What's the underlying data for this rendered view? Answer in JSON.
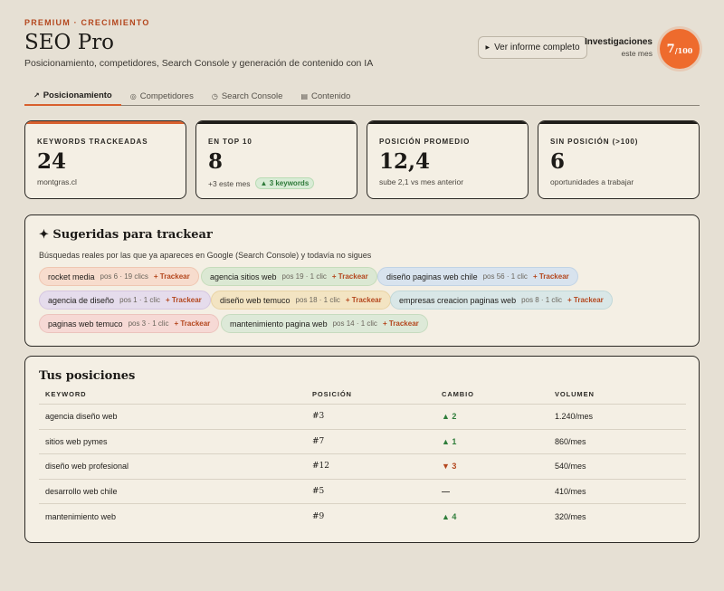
{
  "header": {
    "eyebrow": "PREMIUM · CRECIMIENTO",
    "title": "SEO Pro",
    "subtitle": "Posicionamiento, competidores, Search Console y generación de contenido con IA",
    "report_button": "Ver informe completo",
    "investigations_title": "Investigaciones",
    "investigations_sub": "este mes",
    "quota_used": "7",
    "quota_total": "/100"
  },
  "tabs": [
    {
      "icon": "↗",
      "label": "Posicionamiento"
    },
    {
      "icon": "◎",
      "label": "Competidores"
    },
    {
      "icon": "◷",
      "label": "Search Console"
    },
    {
      "icon": "▤",
      "label": "Contenido"
    }
  ],
  "stats": [
    {
      "label": "KEYWORDS TRACKEADAS",
      "value": "24",
      "note": "montgras.cl",
      "pill": ""
    },
    {
      "label": "EN TOP 10",
      "value": "8",
      "note": "+3 este mes",
      "pill": "▲ 3 keywords"
    },
    {
      "label": "POSICIÓN PROMEDIO",
      "value": "12,4",
      "note": "sube 2,1 vs mes anterior",
      "pill": ""
    },
    {
      "label": "SIN POSICIÓN (>100)",
      "value": "6",
      "note": "oportunidades a trabajar",
      "pill": ""
    }
  ],
  "suggestions": {
    "title": "✦ Sugeridas para trackear",
    "description": "Búsquedas reales por las que ya apareces en Google (Search Console) y todavía no sigues",
    "add_label": "+ Trackear",
    "chips": [
      {
        "keyword": "rocket media",
        "meta": "pos 6 · 19 clics"
      },
      {
        "keyword": "agencia sitios web",
        "meta": "pos 19 · 1 clic"
      },
      {
        "keyword": "diseño paginas web chile",
        "meta": "pos 56 · 1 clic"
      },
      {
        "keyword": "agencia de diseño",
        "meta": "pos 1 · 1 clic"
      },
      {
        "keyword": "diseño web temuco",
        "meta": "pos 18 · 1 clic"
      },
      {
        "keyword": "empresas creacion paginas web",
        "meta": "pos 8 · 1 clic"
      },
      {
        "keyword": "paginas web temuco",
        "meta": "pos 3 · 1 clic"
      },
      {
        "keyword": "mantenimiento pagina web",
        "meta": "pos 14 · 1 clic"
      }
    ]
  },
  "positions": {
    "title": "Tus posiciones",
    "headers": [
      "KEYWORD",
      "POSICIÓN",
      "CAMBIO",
      "VOLUMEN"
    ],
    "rows": [
      {
        "keyword": "agencia diseño web",
        "position": "#3",
        "change": "▲ 2",
        "trend": "up",
        "volume": "1.240/mes"
      },
      {
        "keyword": "sitios web pymes",
        "position": "#7",
        "change": "▲ 1",
        "trend": "up",
        "volume": "860/mes"
      },
      {
        "keyword": "diseño web profesional",
        "position": "#12",
        "change": "▼ 3",
        "trend": "down",
        "volume": "540/mes"
      },
      {
        "keyword": "desarrollo web chile",
        "position": "#5",
        "change": "—",
        "trend": "flat",
        "volume": "410/mes"
      },
      {
        "keyword": "mantenimiento web",
        "position": "#9",
        "change": "▲ 4",
        "trend": "up",
        "volume": "320/mes"
      }
    ]
  },
  "colors": {
    "accent": "#ee6b2d",
    "background": "#e6e0d4",
    "card": "#f4efe4",
    "up": "#2e7d3a",
    "down": "#b4471e"
  }
}
